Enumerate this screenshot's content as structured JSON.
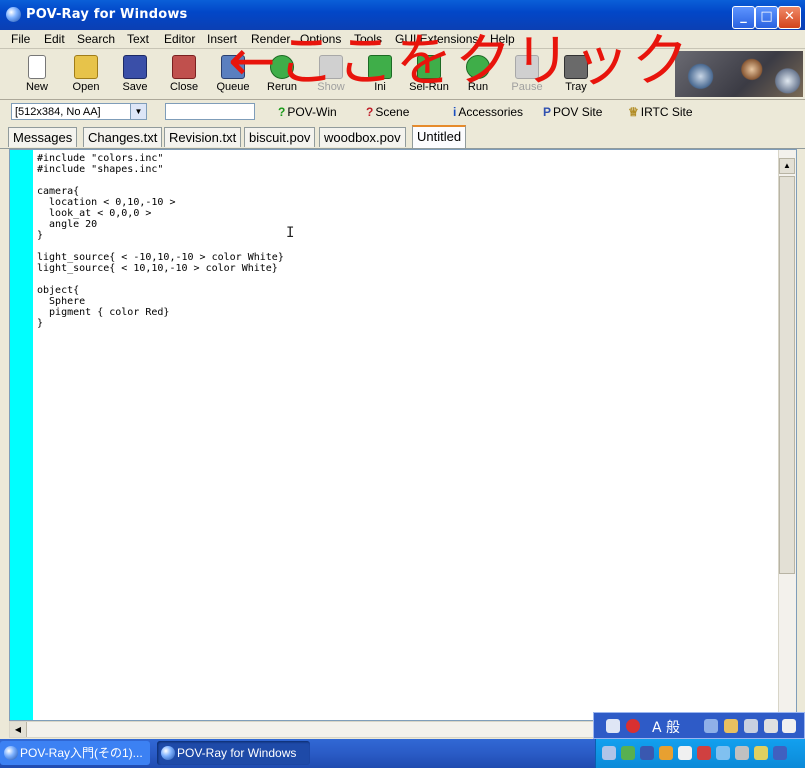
{
  "window": {
    "title": "POV-Ray for Windows",
    "controls": {
      "minimize": "_",
      "maximize": "□",
      "close": "✕"
    }
  },
  "menu": [
    "File",
    "Edit",
    "Search",
    "Text",
    "Editor",
    "Insert",
    "Render",
    "Options",
    "Tools",
    "GUI Extensions",
    "Help"
  ],
  "toolbar": {
    "buttons": [
      {
        "label": "New",
        "icon": "new-file-icon",
        "color": "#ffffff"
      },
      {
        "label": "Open",
        "icon": "folder-open-icon",
        "color": "#e7c34a"
      },
      {
        "label": "Save",
        "icon": "floppy-disk-icon",
        "color": "#3a4fa8"
      },
      {
        "label": "Close",
        "icon": "close-file-icon",
        "color": "#c0504d"
      },
      {
        "label": "Queue",
        "icon": "queue-icon",
        "color": "#5a7fbf"
      },
      {
        "label": "Rerun",
        "icon": "rerun-icon",
        "color": "#3fae49"
      },
      {
        "label": "Show",
        "icon": "show-icon",
        "color": "#c8c8c8",
        "disabled": true
      },
      {
        "label": "Ini",
        "icon": "ini-icon",
        "color": "#3fae49"
      },
      {
        "label": "Sel-Run",
        "icon": "sel-run-icon",
        "color": "#3fae49"
      },
      {
        "label": "Run",
        "icon": "run-icon",
        "color": "#3fae49"
      },
      {
        "label": "Pause",
        "icon": "pause-icon",
        "color": "#c8c8c8",
        "disabled": true
      },
      {
        "label": "Tray",
        "icon": "tray-icon",
        "color": "#6a6a6a"
      }
    ]
  },
  "row2": {
    "resolution": "[512x384, No AA]",
    "command_value": "",
    "links": [
      {
        "label": "POV-Win",
        "glyph": "?",
        "color": "#1a9a1a"
      },
      {
        "label": "Scene",
        "glyph": "?",
        "color": "#c0202a"
      },
      {
        "label": "Accessories",
        "glyph": "i",
        "color": "#1a4fc0"
      },
      {
        "label": "POV Site",
        "glyph": "P",
        "color": "#3050b0"
      },
      {
        "label": "IRTC Site",
        "glyph": "♕",
        "color": "#b08a20"
      }
    ]
  },
  "tabs": [
    "Messages",
    "Changes.txt",
    "Revision.txt",
    "biscuit.pov",
    "woodbox.pov",
    "Untitled"
  ],
  "editor": {
    "code": "#include \"colors.inc\"\n#include \"shapes.inc\"\n\ncamera{\n  location < 0,10,-10 >\n  look_at < 0,0,0 >\n  angle 20\n}\n\nlight_source{ < -10,10,-10 > color White}\nlight_source{ < 10,10,-10 > color White}\n\nobject{\n  Sphere\n  pigment { color Red}\n}"
  },
  "annotation": {
    "text": "←ここをクリック",
    "color": "#e8140c"
  },
  "languagebar": {
    "text": "A 般"
  },
  "taskbar": {
    "tasks": [
      "POV-Ray入門(その1)...",
      "POV-Ray for Windows"
    ]
  },
  "colors": {
    "gutter": "#00ffff",
    "titlebar": "#0247c8",
    "taskbar": "#2a5bc6"
  }
}
